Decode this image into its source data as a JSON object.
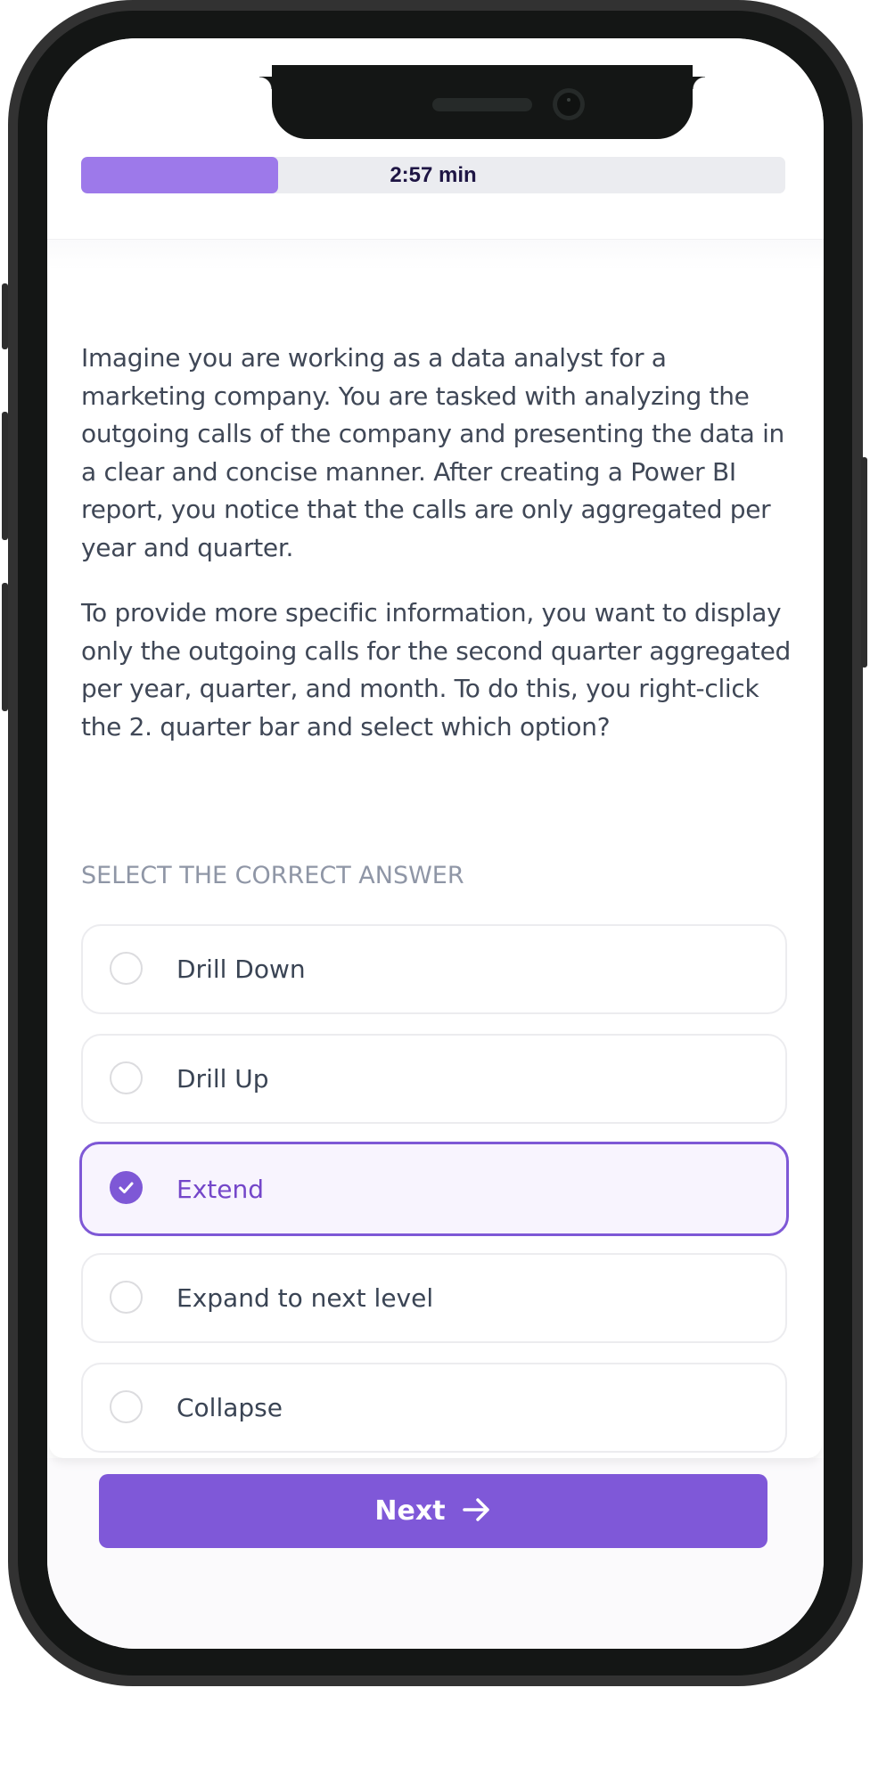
{
  "quiz": {
    "timer": {
      "label": "2:57 min",
      "progress_fraction": 0.28
    },
    "question": {
      "paragraphs": [
        "Imagine you are working as a data analyst for a marketing company. You are tasked with analyzing the outgoing calls of the company and presenting the data in a clear and concise manner. After creating a Power BI report, you notice that the calls are only aggregated per year and quarter.",
        "To provide more specific information, you want to display only the outgoing calls for the second quarter aggregated per year, quarter, and month. To do this, you right-click the 2. quarter bar and select which option?"
      ]
    },
    "prompt": "SELECT THE CORRECT ANSWER",
    "options": [
      {
        "label": "Drill Down",
        "selected": false
      },
      {
        "label": "Drill Up",
        "selected": false
      },
      {
        "label": "Extend",
        "selected": true
      },
      {
        "label": "Expand to next level",
        "selected": false
      },
      {
        "label": "Collapse",
        "selected": false
      }
    ],
    "next_button": {
      "label": "Next",
      "icon": "arrow-right-icon"
    }
  },
  "colors": {
    "accent": "#7f58d8",
    "progress_fill": "#9d79ea",
    "progress_track": "#ebecf0",
    "selected_bg": "#f8f4fe",
    "text": "#3f4756",
    "muted": "#8f96a6"
  }
}
